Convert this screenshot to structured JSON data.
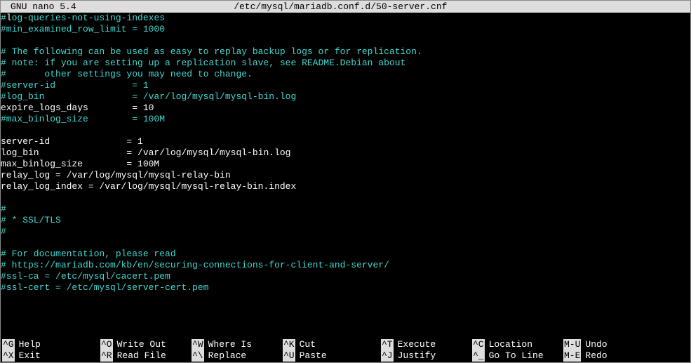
{
  "titlebar": {
    "app": "  GNU nano 5.4",
    "file": "/etc/mysql/mariadb.conf.d/50-server.cnf"
  },
  "lines": [
    {
      "segments": [
        {
          "cls": "cyan",
          "text": "#"
        },
        {
          "cls": "white",
          "text": "l"
        },
        {
          "cls": "cyan",
          "text": "og-queries-not-using-indexes"
        }
      ]
    },
    {
      "segments": [
        {
          "cls": "cyan",
          "text": "#min_examined_row_limit = 1000"
        }
      ]
    },
    {
      "segments": [
        {
          "cls": "",
          "text": " "
        }
      ]
    },
    {
      "segments": [
        {
          "cls": "cyan",
          "text": "# The following can be used as easy to replay backup logs or for replication."
        }
      ]
    },
    {
      "segments": [
        {
          "cls": "cyan",
          "text": "# note: if you are setting up a replication slave, see README.Debian about"
        }
      ]
    },
    {
      "segments": [
        {
          "cls": "cyan",
          "text": "#       other settings you may need to change."
        }
      ]
    },
    {
      "segments": [
        {
          "cls": "cyan",
          "text": "#server-id              = 1"
        }
      ]
    },
    {
      "segments": [
        {
          "cls": "cyan",
          "text": "#log_bin                = /var/log/mysql/mysql-bin.log"
        }
      ]
    },
    {
      "segments": [
        {
          "cls": "white",
          "text": "expire_logs_days        = 10"
        }
      ]
    },
    {
      "segments": [
        {
          "cls": "cyan",
          "text": "#max_binlog_size        = 100M"
        }
      ]
    },
    {
      "segments": [
        {
          "cls": "",
          "text": " "
        }
      ]
    },
    {
      "segments": [
        {
          "cls": "white",
          "text": "server-id              = 1"
        }
      ]
    },
    {
      "segments": [
        {
          "cls": "white",
          "text": "log_bin                = /var/log/mysql/mysql-bin.log"
        }
      ]
    },
    {
      "segments": [
        {
          "cls": "white",
          "text": "max_binlog_size        = 100M"
        }
      ]
    },
    {
      "segments": [
        {
          "cls": "white",
          "text": "relay_log = /var/log/mysql/mysql-relay-bin"
        }
      ]
    },
    {
      "segments": [
        {
          "cls": "white",
          "text": "relay_log_index = /var/log/mysql/mysql-relay-bin.index"
        }
      ]
    },
    {
      "segments": [
        {
          "cls": "",
          "text": " "
        }
      ]
    },
    {
      "segments": [
        {
          "cls": "cyan",
          "text": "#"
        }
      ]
    },
    {
      "segments": [
        {
          "cls": "cyan",
          "text": "# * SSL/TLS"
        }
      ]
    },
    {
      "segments": [
        {
          "cls": "cyan",
          "text": "#"
        }
      ]
    },
    {
      "segments": [
        {
          "cls": "",
          "text": " "
        }
      ]
    },
    {
      "segments": [
        {
          "cls": "cyan",
          "text": "# For documentation, please read"
        }
      ]
    },
    {
      "segments": [
        {
          "cls": "cyan",
          "text": "# https://mariadb.com/kb/en/securing-connections-for-client-and-server/"
        }
      ]
    },
    {
      "segments": [
        {
          "cls": "cyan",
          "text": "#ssl-ca = /etc/mysql/cacert.pem"
        }
      ]
    },
    {
      "segments": [
        {
          "cls": "cyan",
          "text": "#ssl-cert = /etc/mysql/server-cert.pem"
        }
      ]
    }
  ],
  "help": [
    [
      {
        "key": "^G",
        "label": "Help",
        "w": 140
      },
      {
        "key": "^O",
        "label": "Write Out",
        "w": 130
      },
      {
        "key": "^W",
        "label": "Where Is",
        "w": 130
      },
      {
        "key": "^K",
        "label": "Cut",
        "w": 140
      },
      {
        "key": "^T",
        "label": "Execute",
        "w": 130
      },
      {
        "key": "^C",
        "label": "Location",
        "w": 130
      },
      {
        "key": "M-U",
        "label": "Undo",
        "w": 120
      }
    ],
    [
      {
        "key": "^X",
        "label": "Exit",
        "w": 140
      },
      {
        "key": "^R",
        "label": "Read File",
        "w": 130
      },
      {
        "key": "^\\",
        "label": "Replace",
        "w": 130
      },
      {
        "key": "^U",
        "label": "Paste",
        "w": 140
      },
      {
        "key": "^J",
        "label": "Justify",
        "w": 130
      },
      {
        "key": "^_",
        "label": "Go To Line",
        "w": 130
      },
      {
        "key": "M-E",
        "label": "Redo",
        "w": 120
      }
    ]
  ]
}
